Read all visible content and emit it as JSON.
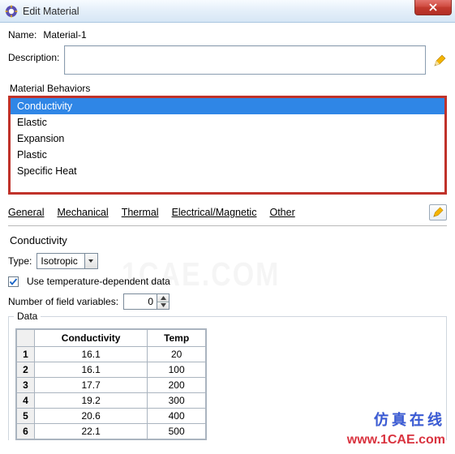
{
  "window": {
    "title": "Edit Material"
  },
  "form": {
    "name_label": "Name:",
    "name_value": "Material-1",
    "description_label": "Description:",
    "description_value": ""
  },
  "behaviors": {
    "label": "Material Behaviors",
    "items": [
      {
        "label": "Conductivity",
        "selected": true
      },
      {
        "label": "Elastic",
        "selected": false
      },
      {
        "label": "Expansion",
        "selected": false
      },
      {
        "label": "Plastic",
        "selected": false
      },
      {
        "label": "Specific Heat",
        "selected": false
      }
    ]
  },
  "menu": {
    "items": [
      "General",
      "Mechanical",
      "Thermal",
      "Electrical/Magnetic",
      "Other"
    ]
  },
  "conductivity": {
    "title": "Conductivity",
    "type_label": "Type:",
    "type_value": "Isotropic",
    "temp_dep_label": "Use temperature-dependent data",
    "temp_dep_checked": true,
    "num_field_vars_label": "Number of field variables:",
    "num_field_vars_value": "0",
    "data_label": "Data",
    "columns": [
      "Conductivity",
      "Temp"
    ],
    "rows": [
      {
        "n": "1",
        "c": "16.1",
        "t": "20"
      },
      {
        "n": "2",
        "c": "16.1",
        "t": "100"
      },
      {
        "n": "3",
        "c": "17.7",
        "t": "200"
      },
      {
        "n": "4",
        "c": "19.2",
        "t": "300"
      },
      {
        "n": "5",
        "c": "20.6",
        "t": "400"
      },
      {
        "n": "6",
        "c": "22.1",
        "t": "500"
      }
    ]
  },
  "watermarks": {
    "cn": "仿真在线",
    "url": "www.1CAE.com"
  }
}
